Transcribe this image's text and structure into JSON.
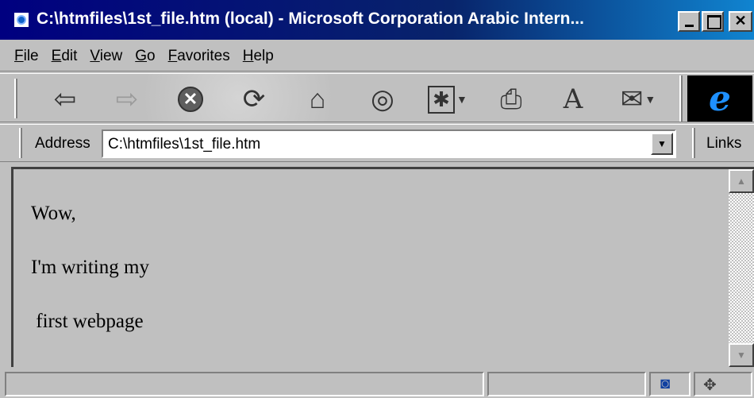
{
  "window": {
    "title": "C:\\htmfiles\\1st_file.htm (local) - Microsoft Corporation Arabic Intern...",
    "minimize_label": "",
    "maximize_label": "",
    "close_label": "✕"
  },
  "menu": {
    "items": [
      {
        "label": "File"
      },
      {
        "label": "Edit"
      },
      {
        "label": "View"
      },
      {
        "label": "Go"
      },
      {
        "label": "Favorites"
      },
      {
        "label": "Help"
      }
    ]
  },
  "toolbar": {
    "back_icon": "⇦",
    "forward_icon": "⇨",
    "stop_icon": "✕",
    "refresh_icon": "⟳",
    "home_icon": "⌂",
    "search_icon": "◎",
    "favorites_icon": "✱",
    "print_icon": "⎙",
    "font_icon": "A",
    "mail_icon": "✉",
    "ie_logo": "e"
  },
  "address": {
    "label": "Address",
    "value": "C:\\htmfiles\\1st_file.htm",
    "dropdown_icon": "▼",
    "links_label": "Links"
  },
  "page": {
    "lines": [
      "Wow,",
      "I'm writing my",
      " first webpage"
    ]
  },
  "scrollbar": {
    "up_icon": "▲",
    "down_icon": "▼"
  },
  "status": {
    "text": "",
    "zone_icon": "◙",
    "connection_icon": "✥"
  },
  "colors": {
    "title_bar": "#000080",
    "chrome": "#c0c0c0",
    "ie_logo_bg": "#000000",
    "ie_logo_fg": "#1e90ff"
  }
}
